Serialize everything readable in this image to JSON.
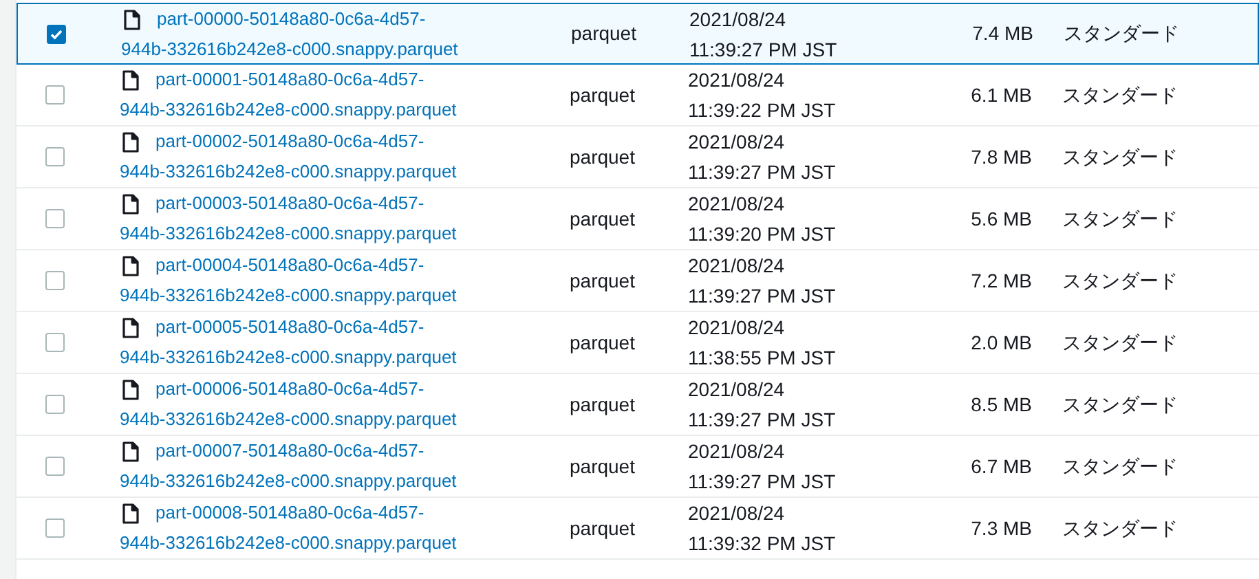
{
  "rows": [
    {
      "selected": true,
      "name": "part-00000-50148a80-0c6a-4d57-944b-332616b242e8-c000.snappy.parquet",
      "type": "parquet",
      "date": "2021/08/24",
      "time": "11:39:27 PM JST",
      "size": "7.4 MB",
      "storage_class": "スタンダード"
    },
    {
      "selected": false,
      "name": "part-00001-50148a80-0c6a-4d57-944b-332616b242e8-c000.snappy.parquet",
      "type": "parquet",
      "date": "2021/08/24",
      "time": "11:39:22 PM JST",
      "size": "6.1 MB",
      "storage_class": "スタンダード"
    },
    {
      "selected": false,
      "name": "part-00002-50148a80-0c6a-4d57-944b-332616b242e8-c000.snappy.parquet",
      "type": "parquet",
      "date": "2021/08/24",
      "time": "11:39:27 PM JST",
      "size": "7.8 MB",
      "storage_class": "スタンダード"
    },
    {
      "selected": false,
      "name": "part-00003-50148a80-0c6a-4d57-944b-332616b242e8-c000.snappy.parquet",
      "type": "parquet",
      "date": "2021/08/24",
      "time": "11:39:20 PM JST",
      "size": "5.6 MB",
      "storage_class": "スタンダード"
    },
    {
      "selected": false,
      "name": "part-00004-50148a80-0c6a-4d57-944b-332616b242e8-c000.snappy.parquet",
      "type": "parquet",
      "date": "2021/08/24",
      "time": "11:39:27 PM JST",
      "size": "7.2 MB",
      "storage_class": "スタンダード"
    },
    {
      "selected": false,
      "name": "part-00005-50148a80-0c6a-4d57-944b-332616b242e8-c000.snappy.parquet",
      "type": "parquet",
      "date": "2021/08/24",
      "time": "11:38:55 PM JST",
      "size": "2.0 MB",
      "storage_class": "スタンダード"
    },
    {
      "selected": false,
      "name": "part-00006-50148a80-0c6a-4d57-944b-332616b242e8-c000.snappy.parquet",
      "type": "parquet",
      "date": "2021/08/24",
      "time": "11:39:27 PM JST",
      "size": "8.5 MB",
      "storage_class": "スタンダード"
    },
    {
      "selected": false,
      "name": "part-00007-50148a80-0c6a-4d57-944b-332616b242e8-c000.snappy.parquet",
      "type": "parquet",
      "date": "2021/08/24",
      "time": "11:39:27 PM JST",
      "size": "6.7 MB",
      "storage_class": "スタンダード"
    },
    {
      "selected": false,
      "name": "part-00008-50148a80-0c6a-4d57-944b-332616b242e8-c000.snappy.parquet",
      "type": "parquet",
      "date": "2021/08/24",
      "time": "11:39:32 PM JST",
      "size": "7.3 MB",
      "storage_class": "スタンダード"
    }
  ]
}
